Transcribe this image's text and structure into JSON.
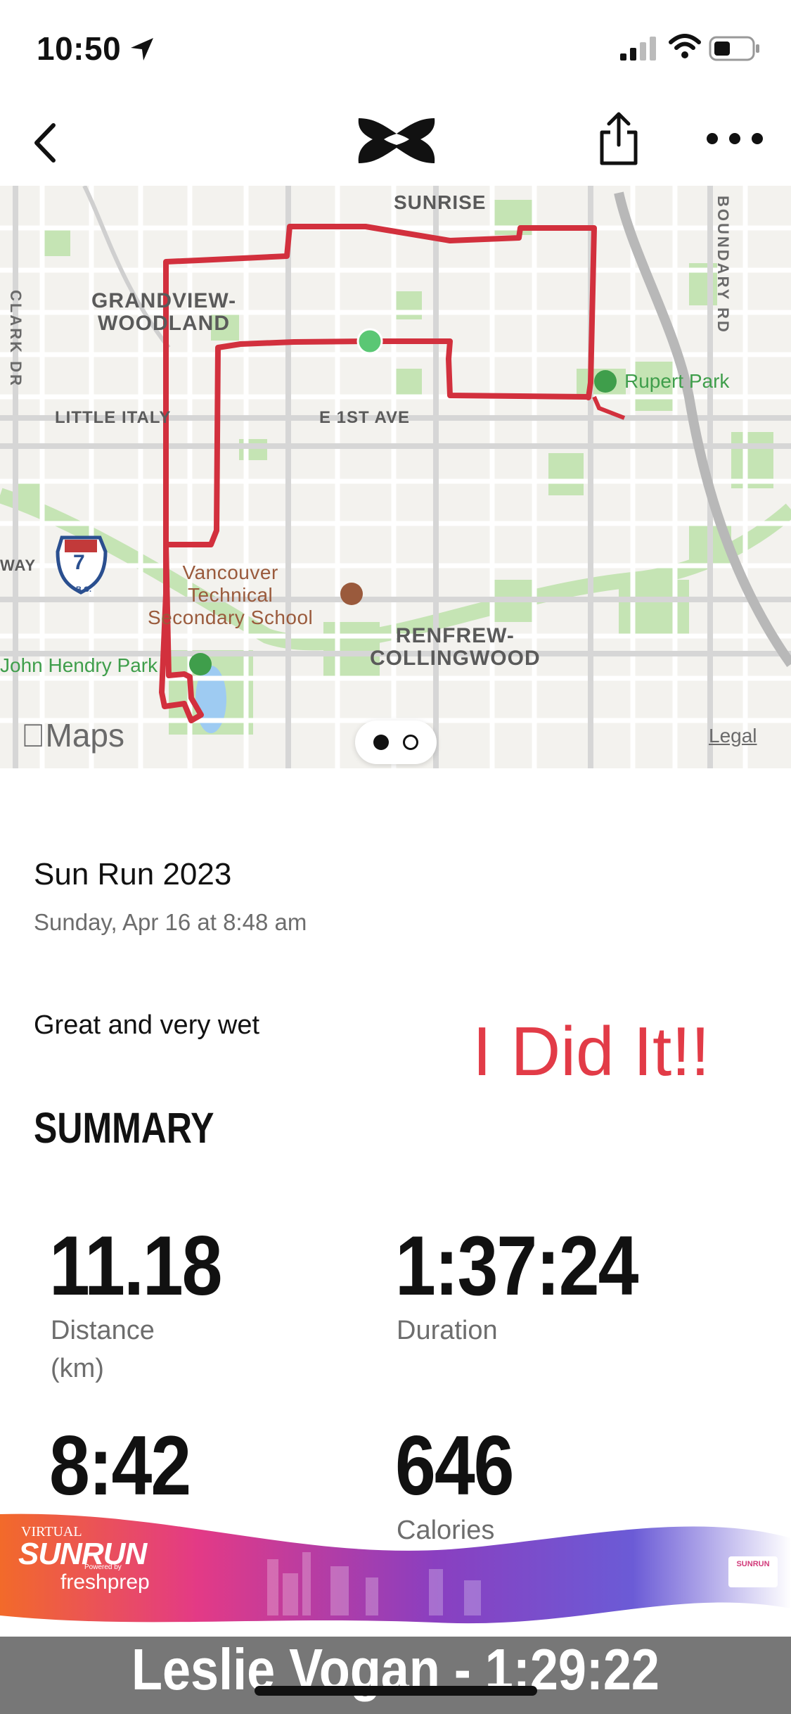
{
  "status_bar": {
    "time": "10:50"
  },
  "map": {
    "labels": {
      "sunrise": "SUNRISE",
      "grandview": "GRANDVIEW-\nWOODLAND",
      "clark": "CLARK DR",
      "boundary": "BOUNDARY RD",
      "little_italy": "LITTLE ITALY",
      "first_ave": "E 1ST AVE",
      "rupert": "Rupert Park",
      "way": "WAY",
      "highway": "7",
      "highway_sub": "B.C.",
      "vtech": "Vancouver\nTechnical\nSecondary School",
      "renfrew": "RENFREW-\nCOLLINGWOOD",
      "hendry": "John Hendry Park",
      "maps": "Maps",
      "legal": "Legal"
    }
  },
  "activity": {
    "title": "Sun Run 2023",
    "date": "Sunday, Apr 16 at 8:48 am",
    "notes": "Great and very wet",
    "annotation": "I Did It!!"
  },
  "summary": {
    "heading": "SUMMARY",
    "stats": [
      {
        "value": "11.18",
        "label": "Distance\n(km)"
      },
      {
        "value": "1:37:24",
        "label": "Duration"
      },
      {
        "value": "8:42",
        "label": ""
      },
      {
        "value": "646",
        "label": "Calories"
      }
    ]
  },
  "banner": {
    "virtual": "VIRTUAL",
    "logo": "SUNRUN",
    "powered": "Powered by",
    "sponsor": "freshprep",
    "footer": "Leslie Vogan - 1:29:22"
  },
  "colors": {
    "route": "#d2303d",
    "accent": "#e23b47",
    "park": "#3f9e4b"
  }
}
